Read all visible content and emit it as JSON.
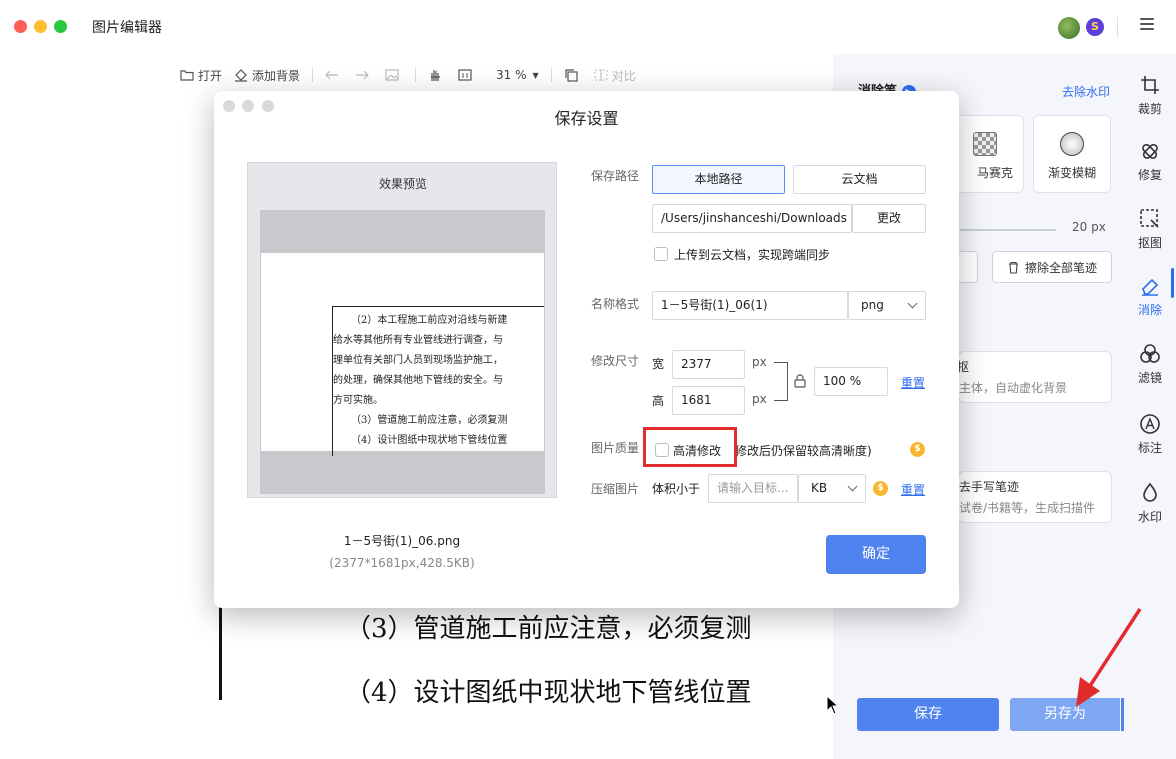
{
  "app": {
    "title": "图片编辑器",
    "traffic_colors": [
      "#fe5f57",
      "#febc2e",
      "#28c840"
    ],
    "vip_badge": "S"
  },
  "toolbar": {
    "open_label": "打开",
    "add_bg_label": "添加背景",
    "zoom": "31 %",
    "compare_label": "对比"
  },
  "document": {
    "line3": "（3）管道施工前应注意，必须复测",
    "line4": "（4）设计图纸中现状地下管线位置"
  },
  "right_panel": {
    "section_title": "消除笔",
    "remove_watermark": "去除水印",
    "tools": [
      {
        "label": "马赛克",
        "icon": "mosaic-icon"
      },
      {
        "label": "渐变模糊",
        "icon": "gradient-blur-icon"
      }
    ],
    "brush_size": "20 px",
    "erase_all": "擦除全部笔迹",
    "card1_title": "抠",
    "card1_sub": "主体，自动虚化背景",
    "card2_title": "去手写笔迹",
    "card2_sub": "试卷/书籍等，生成扫描件",
    "save": "保存",
    "save_as": "另存为"
  },
  "side_tabs": [
    {
      "label": "裁剪",
      "icon": "crop-icon"
    },
    {
      "label": "修复",
      "icon": "bandage-icon"
    },
    {
      "label": "抠图",
      "icon": "cutout-icon"
    },
    {
      "label": "消除",
      "icon": "eraser-icon"
    },
    {
      "label": "滤镜",
      "icon": "filter-icon"
    },
    {
      "label": "标注",
      "icon": "annotate-icon"
    },
    {
      "label": "水印",
      "icon": "watermark-icon"
    }
  ],
  "dialog": {
    "title": "保存设置",
    "preview_label": "效果预览",
    "preview_lines": [
      "（2）本工程施工前应对沿线与新建",
      "给水等其他所有专业管线进行调查，与",
      "理单位有关部门人员到现场监护施工，",
      "的处理，确保其他地下管线的安全。与",
      "方可实施。",
      "（3）管道施工前应注意，必须复测",
      "（4）设计图纸中现状地下管线位置"
    ],
    "file_name": "1－5号街(1)_06.png",
    "file_meta": "(2377*1681px,428.5KB)",
    "save_path_label": "保存路径",
    "local_path": "本地路径",
    "cloud_doc": "云文档",
    "path_value": "/Users/jinshanceshi/Downloads",
    "change": "更改",
    "upload_cloud": "上传到云文档，实现跨端同步",
    "name_format_label": "名称格式",
    "name_value": "1－5号街(1)_06(1)",
    "format": "png",
    "resize_label": "修改尺寸",
    "width_label": "宽",
    "width_value": "2377",
    "height_label": "高",
    "height_value": "1681",
    "px": "px",
    "percent": "100 %",
    "reset": "重置",
    "quality_label": "图片质量",
    "hd_label": "高清修改",
    "hd_note": "修改后仍保留较高清晰度)",
    "compress_label": "压缩图片",
    "size_less": "体积小于",
    "target_placeholder": "请输入目标...",
    "unit": "KB",
    "confirm": "确定"
  }
}
